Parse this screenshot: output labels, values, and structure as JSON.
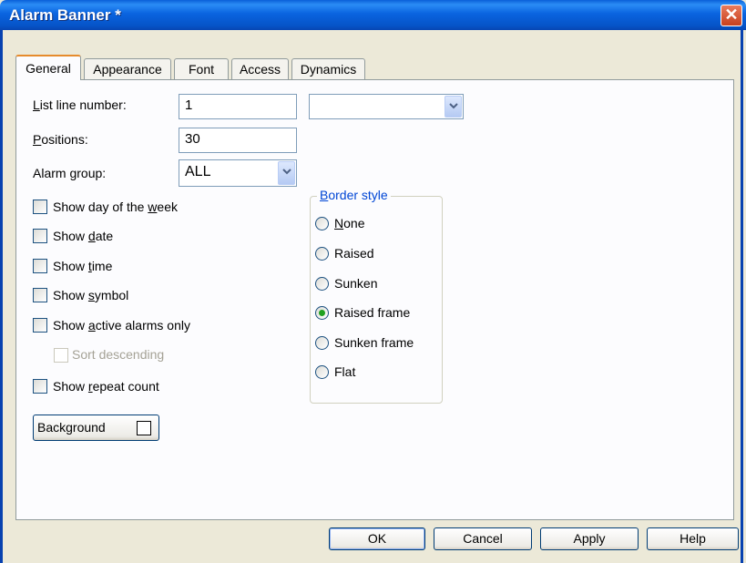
{
  "window": {
    "title": "Alarm Banner *",
    "close_glyph": "✕"
  },
  "tabs": [
    "General",
    "Appearance",
    "Font",
    "Access",
    "Dynamics"
  ],
  "fields": {
    "list_line_number": {
      "label_pre": "",
      "label_ul": "L",
      "label_post": "ist line number:",
      "value": "1",
      "extra_select": ""
    },
    "positions": {
      "label_ul": "P",
      "label_post": "ositions:",
      "value": "30"
    },
    "alarm_group": {
      "label_pre": "Alarm ",
      "label_ul": "g",
      "label_post": "roup:",
      "value": "ALL"
    }
  },
  "checkboxes": [
    {
      "pre": "Show day of the ",
      "ul": "w",
      "post": "eek",
      "checked": false,
      "enabled": true
    },
    {
      "pre": "Show ",
      "ul": "d",
      "post": "ate",
      "checked": false,
      "enabled": true
    },
    {
      "pre": "Show ",
      "ul": "t",
      "post": "ime",
      "checked": false,
      "enabled": true
    },
    {
      "pre": "Show ",
      "ul": "s",
      "post": "ymbol",
      "checked": false,
      "enabled": true
    },
    {
      "pre": "Show ",
      "ul": "a",
      "post": "ctive alarms only",
      "checked": false,
      "enabled": true
    },
    {
      "pre": "Sort descending",
      "ul": "",
      "post": "",
      "checked": false,
      "enabled": false
    },
    {
      "pre": "Show ",
      "ul": "r",
      "post": "epeat count",
      "checked": false,
      "enabled": true
    }
  ],
  "background_button": {
    "label": "Background"
  },
  "border_style": {
    "title_ul": "B",
    "title_post": "order style",
    "options": [
      {
        "pre": "",
        "ul": "N",
        "post": "one",
        "selected": false
      },
      {
        "pre": "Raised",
        "ul": "",
        "post": "",
        "selected": false
      },
      {
        "pre": "Sunken",
        "ul": "",
        "post": "",
        "selected": false
      },
      {
        "pre": "Raised frame",
        "ul": "",
        "post": "",
        "selected": true
      },
      {
        "pre": "Sunken frame",
        "ul": "",
        "post": "",
        "selected": false
      },
      {
        "pre": "Flat",
        "ul": "",
        "post": "",
        "selected": false
      }
    ]
  },
  "buttons": {
    "ok": "OK",
    "cancel": "Cancel",
    "apply": "Apply",
    "help": "Help"
  },
  "icons": {
    "dropdown": "chevron-down-icon",
    "close": "close-icon"
  },
  "colors": {
    "titlebar": "#0a64e0",
    "tab_highlight": "#e68b2c",
    "radio_selected": "#21a121",
    "group_title": "#0046d5"
  }
}
